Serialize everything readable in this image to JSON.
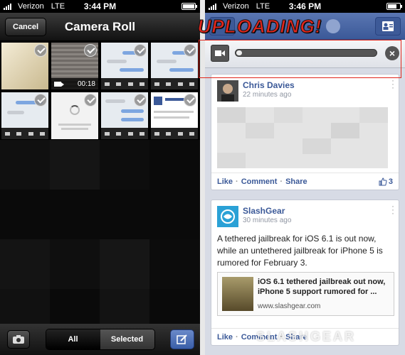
{
  "left_phone": {
    "status": {
      "carrier": "Verizon",
      "network": "LTE",
      "time": "3:44 PM"
    },
    "nav": {
      "cancel_label": "Cancel",
      "title": "Camera Roll"
    },
    "video_duration": "00:18",
    "segments": {
      "all": "All",
      "selected": "Selected"
    }
  },
  "right_phone": {
    "status": {
      "carrier": "Verizon",
      "network": "LTE",
      "time": "3:46 PM"
    },
    "overlay_label": "UPLOADING!",
    "upload_progress": 0.02,
    "posts": [
      {
        "author": "Chris Davies",
        "time": "22 minutes ago",
        "actions": {
          "like": "Like",
          "comment": "Comment",
          "share": "Share",
          "like_count": "3"
        }
      },
      {
        "author": "SlashGear",
        "time": "30 minutes ago",
        "text": "A tethered jailbreak for iOS 6.1 is out now, while an untethered jailbreak for iPhone 5 is rumored for February 3.",
        "link": {
          "title": "iOS 6.1 tethered jailbreak out now, iPhone 5 support rumored for ...",
          "url": "www.slashgear.com"
        },
        "actions": {
          "like": "Like",
          "comment": "Comment",
          "share": "Share"
        }
      }
    ]
  },
  "watermark": "SLASHGEAR",
  "colors": {
    "facebook_blue": "#3b5998",
    "overlay_red": "#e1261c",
    "compose_blue": "#4a6fb5"
  }
}
